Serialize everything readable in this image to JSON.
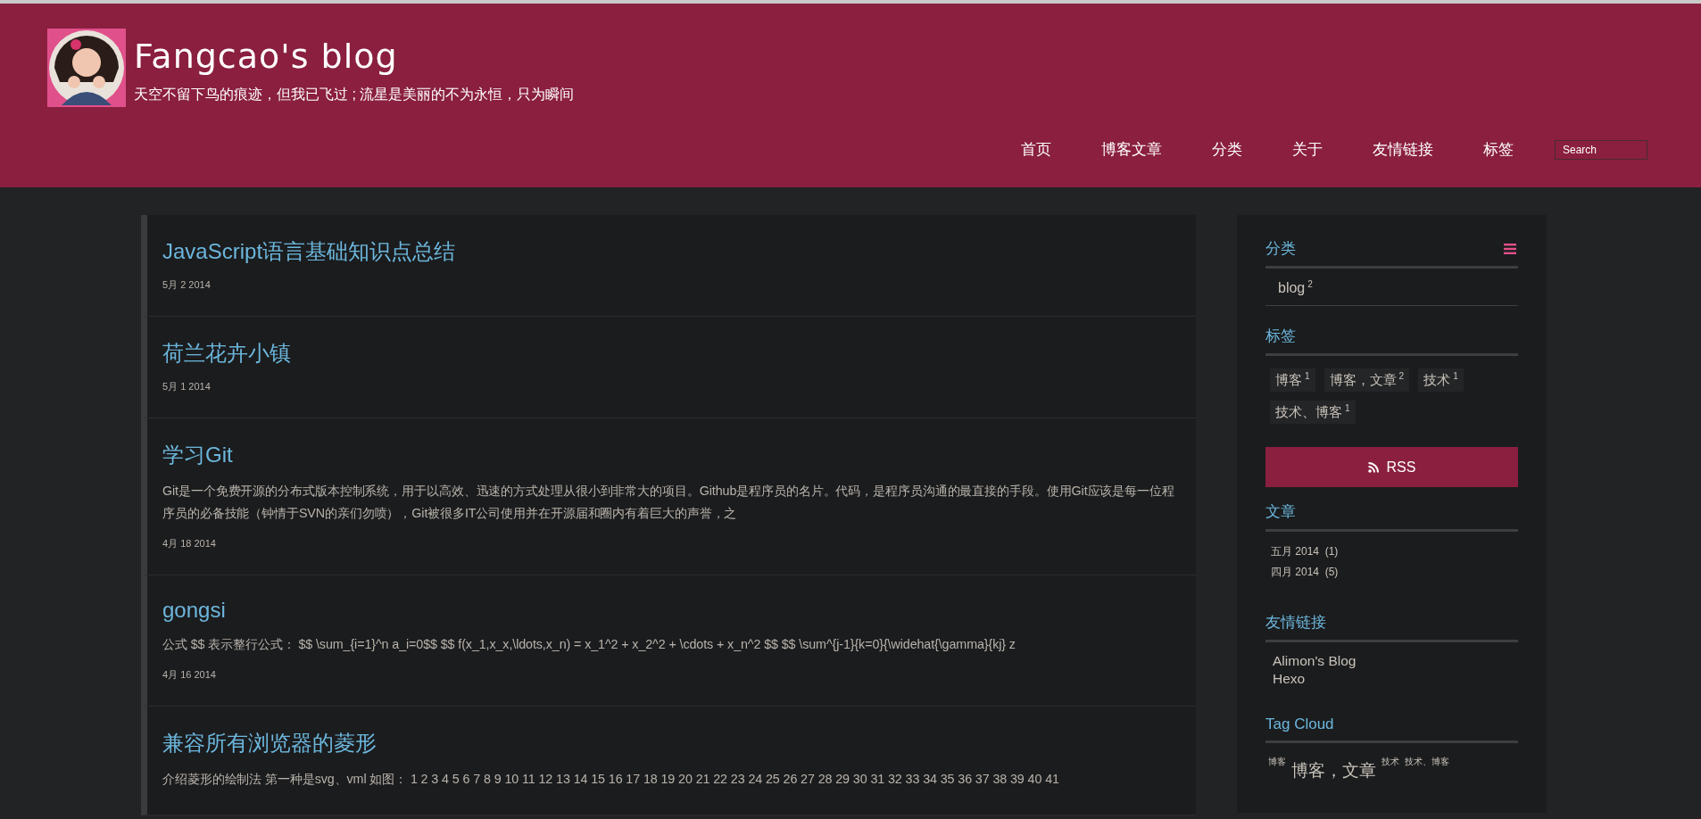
{
  "header": {
    "title": "Fangcao's blog",
    "subtitle": "天空不留下鸟的痕迹，但我已飞过 ; 流星是美丽的不为永恒，只为瞬间",
    "nav": [
      {
        "label": "首页"
      },
      {
        "label": "博客文章"
      },
      {
        "label": "分类"
      },
      {
        "label": "关于"
      },
      {
        "label": "友情链接"
      },
      {
        "label": "标签"
      }
    ],
    "search": {
      "placeholder": "Search"
    }
  },
  "posts": [
    {
      "title": "JavaScript语言基础知识点总结",
      "date": "5月 2 2014"
    },
    {
      "title": "荷兰花卉小镇",
      "date": "5月 1 2014"
    },
    {
      "title": "学习Git",
      "excerpt": "Git是一个免费开源的分布式版本控制系统，用于以高效、迅速的方式处理从很小到非常大的项目。Github是程序员的名片。代码，是程序员沟通的最直接的手段。使用Git应该是每一位程序员的必备技能（钟情于SVN的亲们勿喷），Git被很多IT公司使用并在开源届和圈内有着巨大的声誉，之",
      "date": "4月 18 2014"
    },
    {
      "title": "gongsi",
      "excerpt": "公式 $$ 表示整行公式：  $$ \\sum_{i=1}^n a_i=0$$ $$ f(x_1,x_x,\\ldots,x_n) = x_1^2 + x_2^2 + \\cdots + x_n^2 $$ $$ \\sum^{j-1}{k=0}{\\widehat{\\gamma}{kj} z",
      "date": "4月 16 2014"
    },
    {
      "title": "兼容所有浏览器的菱形",
      "excerpt": "介绍菱形的绘制法 第一种是svg、vml 如图：  1 2 3 4 5 6 7 8 9 10 11 12 13 14 15 16 17 18 19 20 21 22 23 24 25 26 27 28 29 30 31 32 33 34 35 36 37 38 39 40 41"
    }
  ],
  "sidebar": {
    "categories": {
      "heading": "分类",
      "items": [
        {
          "label": "blog",
          "count": "2"
        }
      ]
    },
    "tags": {
      "heading": "标签",
      "items": [
        {
          "label": "博客",
          "count": "1"
        },
        {
          "label": "博客，文章",
          "count": "2"
        },
        {
          "label": "技术",
          "count": "1"
        },
        {
          "label": "技术、博客",
          "count": "1"
        }
      ]
    },
    "rss": {
      "label": "RSS"
    },
    "archives": {
      "heading": "文章",
      "items": [
        {
          "label": "五月 2014",
          "count": "(1)"
        },
        {
          "label": "四月 2014",
          "count": "(5)"
        }
      ]
    },
    "links": {
      "heading": "友情链接",
      "items": [
        {
          "label": "Alimon's Blog"
        },
        {
          "label": "Hexo"
        }
      ]
    },
    "tag_cloud": {
      "heading": "Tag Cloud",
      "items": [
        {
          "label": "博客",
          "kind": "small"
        },
        {
          "label": "博客，文章",
          "kind": "large"
        },
        {
          "label": "技术",
          "kind": "small"
        },
        {
          "label": "技术、博客",
          "kind": "small"
        }
      ]
    }
  }
}
